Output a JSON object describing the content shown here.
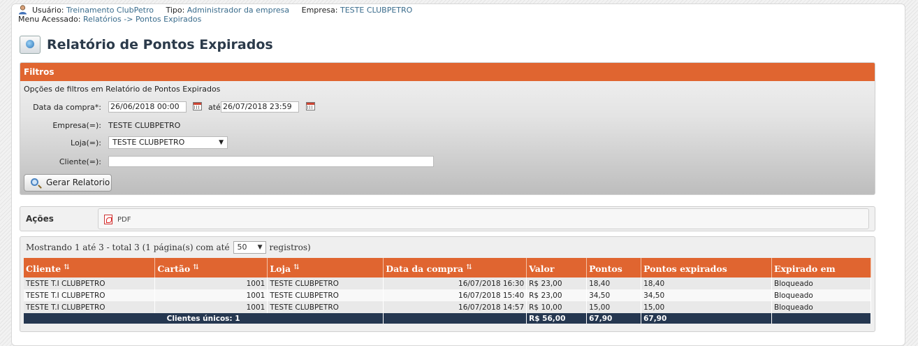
{
  "header": {
    "usuario_label": "Usuário:",
    "usuario_value": "Treinamento ClubPetro",
    "tipo_label": "Tipo:",
    "tipo_value": "Administrador da empresa",
    "empresa_label": "Empresa:",
    "empresa_value": "TESTE CLUBPETRO",
    "menu_label": "Menu Acessado:",
    "menu_value": "Relatórios -> Pontos Expirados"
  },
  "page_title": "Relatório de Pontos Expirados",
  "filters": {
    "title": "Filtros",
    "subtitle": "Opções de filtros em Relatório de Pontos Expirados",
    "data_compra_label": "Data da compra*:",
    "data_inicio": "26/06/2018 00:00",
    "ate_label": "até",
    "data_fim": "26/07/2018 23:59",
    "empresa_label": "Empresa(=):",
    "empresa_value": "TESTE CLUBPETRO",
    "loja_label": "Loja(=):",
    "loja_value": "TESTE CLUBPETRO",
    "cliente_label": "Cliente(=):",
    "cliente_value": "",
    "gerar_button": "Gerar Relatorio"
  },
  "acoes": {
    "label": "Ações",
    "pdf_label": "PDF"
  },
  "grid": {
    "showing_text": "Mostrando 1 até 3 - total 3 (1 página(s) com até",
    "per_page": "50",
    "registros_label": "registros)",
    "columns": [
      "Cliente",
      "Cartão",
      "Loja",
      "Data da compra",
      "Valor",
      "Pontos",
      "Pontos expirados",
      "Expirado em"
    ],
    "rows": [
      {
        "cliente": "TESTE T.I CLUBPETRO",
        "cartao": "1001",
        "loja": "TESTE CLUBPETRO",
        "data": "16/07/2018 16:30",
        "valor": "R$ 23,00",
        "pontos": "18,40",
        "expirados": "18,40",
        "expirado_em": "Bloqueado"
      },
      {
        "cliente": "TESTE T.I CLUBPETRO",
        "cartao": "1001",
        "loja": "TESTE CLUBPETRO",
        "data": "16/07/2018 15:40",
        "valor": "R$ 23,00",
        "pontos": "34,50",
        "expirados": "34,50",
        "expirado_em": "Bloqueado"
      },
      {
        "cliente": "TESTE T.I CLUBPETRO",
        "cartao": "1001",
        "loja": "TESTE CLUBPETRO",
        "data": "16/07/2018 14:57",
        "valor": "R$ 10,00",
        "pontos": "15,00",
        "expirados": "15,00",
        "expirado_em": "Bloqueado"
      }
    ],
    "footer": {
      "clientes_unicos": "Clientes únicos: 1",
      "valor_total": "R$ 56,00",
      "pontos_total": "67,90",
      "expirados_total": "67,90"
    }
  },
  "colors": {
    "accent_orange": "#e06530",
    "footer_navy": "#253750",
    "link_blue": "#3a6c8c"
  }
}
